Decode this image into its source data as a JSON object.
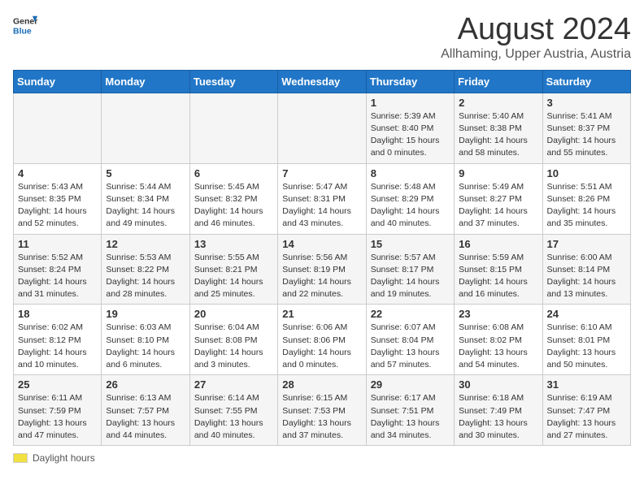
{
  "header": {
    "logo_general": "General",
    "logo_blue": "Blue",
    "title": "August 2024",
    "subtitle": "Allhaming, Upper Austria, Austria"
  },
  "calendar": {
    "days_of_week": [
      "Sunday",
      "Monday",
      "Tuesday",
      "Wednesday",
      "Thursday",
      "Friday",
      "Saturday"
    ],
    "weeks": [
      [
        {
          "date": "",
          "content": ""
        },
        {
          "date": "",
          "content": ""
        },
        {
          "date": "",
          "content": ""
        },
        {
          "date": "",
          "content": ""
        },
        {
          "date": "1",
          "content": "Sunrise: 5:39 AM\nSunset: 8:40 PM\nDaylight: 15 hours and 0 minutes."
        },
        {
          "date": "2",
          "content": "Sunrise: 5:40 AM\nSunset: 8:38 PM\nDaylight: 14 hours and 58 minutes."
        },
        {
          "date": "3",
          "content": "Sunrise: 5:41 AM\nSunset: 8:37 PM\nDaylight: 14 hours and 55 minutes."
        }
      ],
      [
        {
          "date": "4",
          "content": "Sunrise: 5:43 AM\nSunset: 8:35 PM\nDaylight: 14 hours and 52 minutes."
        },
        {
          "date": "5",
          "content": "Sunrise: 5:44 AM\nSunset: 8:34 PM\nDaylight: 14 hours and 49 minutes."
        },
        {
          "date": "6",
          "content": "Sunrise: 5:45 AM\nSunset: 8:32 PM\nDaylight: 14 hours and 46 minutes."
        },
        {
          "date": "7",
          "content": "Sunrise: 5:47 AM\nSunset: 8:31 PM\nDaylight: 14 hours and 43 minutes."
        },
        {
          "date": "8",
          "content": "Sunrise: 5:48 AM\nSunset: 8:29 PM\nDaylight: 14 hours and 40 minutes."
        },
        {
          "date": "9",
          "content": "Sunrise: 5:49 AM\nSunset: 8:27 PM\nDaylight: 14 hours and 37 minutes."
        },
        {
          "date": "10",
          "content": "Sunrise: 5:51 AM\nSunset: 8:26 PM\nDaylight: 14 hours and 35 minutes."
        }
      ],
      [
        {
          "date": "11",
          "content": "Sunrise: 5:52 AM\nSunset: 8:24 PM\nDaylight: 14 hours and 31 minutes."
        },
        {
          "date": "12",
          "content": "Sunrise: 5:53 AM\nSunset: 8:22 PM\nDaylight: 14 hours and 28 minutes."
        },
        {
          "date": "13",
          "content": "Sunrise: 5:55 AM\nSunset: 8:21 PM\nDaylight: 14 hours and 25 minutes."
        },
        {
          "date": "14",
          "content": "Sunrise: 5:56 AM\nSunset: 8:19 PM\nDaylight: 14 hours and 22 minutes."
        },
        {
          "date": "15",
          "content": "Sunrise: 5:57 AM\nSunset: 8:17 PM\nDaylight: 14 hours and 19 minutes."
        },
        {
          "date": "16",
          "content": "Sunrise: 5:59 AM\nSunset: 8:15 PM\nDaylight: 14 hours and 16 minutes."
        },
        {
          "date": "17",
          "content": "Sunrise: 6:00 AM\nSunset: 8:14 PM\nDaylight: 14 hours and 13 minutes."
        }
      ],
      [
        {
          "date": "18",
          "content": "Sunrise: 6:02 AM\nSunset: 8:12 PM\nDaylight: 14 hours and 10 minutes."
        },
        {
          "date": "19",
          "content": "Sunrise: 6:03 AM\nSunset: 8:10 PM\nDaylight: 14 hours and 6 minutes."
        },
        {
          "date": "20",
          "content": "Sunrise: 6:04 AM\nSunset: 8:08 PM\nDaylight: 14 hours and 3 minutes."
        },
        {
          "date": "21",
          "content": "Sunrise: 6:06 AM\nSunset: 8:06 PM\nDaylight: 14 hours and 0 minutes."
        },
        {
          "date": "22",
          "content": "Sunrise: 6:07 AM\nSunset: 8:04 PM\nDaylight: 13 hours and 57 minutes."
        },
        {
          "date": "23",
          "content": "Sunrise: 6:08 AM\nSunset: 8:02 PM\nDaylight: 13 hours and 54 minutes."
        },
        {
          "date": "24",
          "content": "Sunrise: 6:10 AM\nSunset: 8:01 PM\nDaylight: 13 hours and 50 minutes."
        }
      ],
      [
        {
          "date": "25",
          "content": "Sunrise: 6:11 AM\nSunset: 7:59 PM\nDaylight: 13 hours and 47 minutes."
        },
        {
          "date": "26",
          "content": "Sunrise: 6:13 AM\nSunset: 7:57 PM\nDaylight: 13 hours and 44 minutes."
        },
        {
          "date": "27",
          "content": "Sunrise: 6:14 AM\nSunset: 7:55 PM\nDaylight: 13 hours and 40 minutes."
        },
        {
          "date": "28",
          "content": "Sunrise: 6:15 AM\nSunset: 7:53 PM\nDaylight: 13 hours and 37 minutes."
        },
        {
          "date": "29",
          "content": "Sunrise: 6:17 AM\nSunset: 7:51 PM\nDaylight: 13 hours and 34 minutes."
        },
        {
          "date": "30",
          "content": "Sunrise: 6:18 AM\nSunset: 7:49 PM\nDaylight: 13 hours and 30 minutes."
        },
        {
          "date": "31",
          "content": "Sunrise: 6:19 AM\nSunset: 7:47 PM\nDaylight: 13 hours and 27 minutes."
        }
      ]
    ]
  },
  "footer": {
    "daylight_label": "Daylight hours"
  }
}
